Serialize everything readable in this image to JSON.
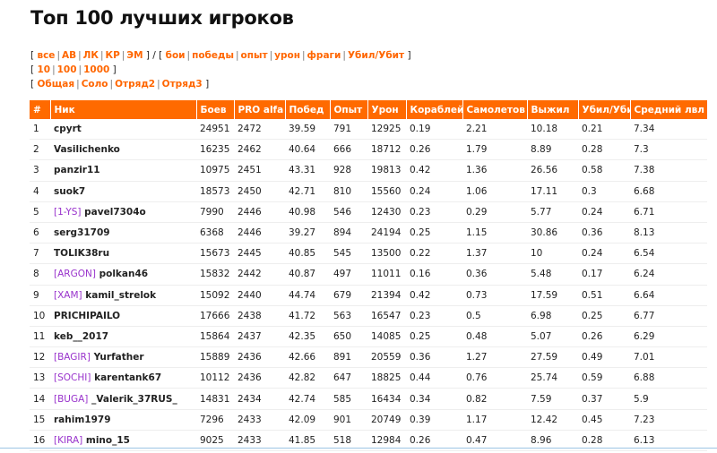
{
  "page": {
    "title": "Топ 100 лучших игроков"
  },
  "filters": {
    "line1_group1": [
      "все",
      "АВ",
      "ЛК",
      "КР",
      "ЭМ"
    ],
    "line1_slash": "/",
    "line1_group2": [
      "бои",
      "победы",
      "опыт",
      "урон",
      "фраги",
      "Убил/Убит"
    ],
    "line2": [
      "10",
      "100",
      "1000"
    ],
    "line3": [
      "Общая",
      "Соло",
      "Отряд2",
      "Отряд3"
    ]
  },
  "table": {
    "columns": [
      "#",
      "Ник",
      "Боев",
      "PRO alfa",
      "Побед",
      "Опыт",
      "Урон",
      "Кораблей",
      "Самолетов",
      "Выжил",
      "Убил/Убит",
      "Средний лвл"
    ],
    "rows": [
      {
        "rank": "1",
        "clan": "",
        "nick": "cpyrt",
        "battles": "24951",
        "pro": "2472",
        "wins": "39.59",
        "exp": "791",
        "dmg": "12925",
        "ships": "0.19",
        "planes": "2.21",
        "survived": "10.18",
        "kd": "0.21",
        "avg_lvl": "7.34"
      },
      {
        "rank": "2",
        "clan": "",
        "nick": "Vasilichenko",
        "battles": "16235",
        "pro": "2462",
        "wins": "40.64",
        "exp": "666",
        "dmg": "18712",
        "ships": "0.26",
        "planes": "1.79",
        "survived": "8.89",
        "kd": "0.28",
        "avg_lvl": "7.3"
      },
      {
        "rank": "3",
        "clan": "",
        "nick": "panzir11",
        "battles": "10975",
        "pro": "2451",
        "wins": "43.31",
        "exp": "928",
        "dmg": "19813",
        "ships": "0.42",
        "planes": "1.36",
        "survived": "26.56",
        "kd": "0.58",
        "avg_lvl": "7.38"
      },
      {
        "rank": "4",
        "clan": "",
        "nick": "suok7",
        "battles": "18573",
        "pro": "2450",
        "wins": "42.71",
        "exp": "810",
        "dmg": "15560",
        "ships": "0.24",
        "planes": "1.06",
        "survived": "17.11",
        "kd": "0.3",
        "avg_lvl": "6.68"
      },
      {
        "rank": "5",
        "clan": "[1-YS]",
        "nick": "pavel7304o",
        "battles": "7990",
        "pro": "2446",
        "wins": "40.98",
        "exp": "546",
        "dmg": "12430",
        "ships": "0.23",
        "planes": "0.29",
        "survived": "5.77",
        "kd": "0.24",
        "avg_lvl": "6.71"
      },
      {
        "rank": "6",
        "clan": "",
        "nick": "serg31709",
        "battles": "6368",
        "pro": "2446",
        "wins": "39.27",
        "exp": "894",
        "dmg": "24194",
        "ships": "0.25",
        "planes": "1.15",
        "survived": "30.86",
        "kd": "0.36",
        "avg_lvl": "8.13"
      },
      {
        "rank": "7",
        "clan": "",
        "nick": "TOLIK38ru",
        "battles": "15673",
        "pro": "2445",
        "wins": "40.85",
        "exp": "545",
        "dmg": "13500",
        "ships": "0.22",
        "planes": "1.37",
        "survived": "10",
        "kd": "0.24",
        "avg_lvl": "6.54"
      },
      {
        "rank": "8",
        "clan": "[ARGON]",
        "nick": "polkan46",
        "battles": "15832",
        "pro": "2442",
        "wins": "40.87",
        "exp": "497",
        "dmg": "11011",
        "ships": "0.16",
        "planes": "0.36",
        "survived": "5.48",
        "kd": "0.17",
        "avg_lvl": "6.24"
      },
      {
        "rank": "9",
        "clan": "[XAM]",
        "nick": "kamil_strelok",
        "battles": "15092",
        "pro": "2440",
        "wins": "44.74",
        "exp": "679",
        "dmg": "21394",
        "ships": "0.42",
        "planes": "0.73",
        "survived": "17.59",
        "kd": "0.51",
        "avg_lvl": "6.64"
      },
      {
        "rank": "10",
        "clan": "",
        "nick": "PRICHIPAILO",
        "battles": "17666",
        "pro": "2438",
        "wins": "41.72",
        "exp": "563",
        "dmg": "16547",
        "ships": "0.23",
        "planes": "0.5",
        "survived": "6.98",
        "kd": "0.25",
        "avg_lvl": "6.77"
      },
      {
        "rank": "11",
        "clan": "",
        "nick": "keb__2017",
        "battles": "15864",
        "pro": "2437",
        "wins": "42.35",
        "exp": "650",
        "dmg": "14085",
        "ships": "0.25",
        "planes": "0.48",
        "survived": "5.07",
        "kd": "0.26",
        "avg_lvl": "6.29"
      },
      {
        "rank": "12",
        "clan": "[BAGIR]",
        "nick": "Yurfather",
        "battles": "15889",
        "pro": "2436",
        "wins": "42.66",
        "exp": "891",
        "dmg": "20559",
        "ships": "0.36",
        "planes": "1.27",
        "survived": "27.59",
        "kd": "0.49",
        "avg_lvl": "7.01"
      },
      {
        "rank": "13",
        "clan": "[SOCHI]",
        "nick": "karentank67",
        "battles": "10112",
        "pro": "2436",
        "wins": "42.82",
        "exp": "647",
        "dmg": "18825",
        "ships": "0.44",
        "planes": "0.76",
        "survived": "25.74",
        "kd": "0.59",
        "avg_lvl": "6.88"
      },
      {
        "rank": "14",
        "clan": "[BUGA]",
        "nick": "_Valerik_37RUS_",
        "battles": "14831",
        "pro": "2434",
        "wins": "42.74",
        "exp": "585",
        "dmg": "16434",
        "ships": "0.34",
        "planes": "0.82",
        "survived": "7.59",
        "kd": "0.37",
        "avg_lvl": "5.9"
      },
      {
        "rank": "15",
        "clan": "",
        "nick": "rahim1979",
        "battles": "7296",
        "pro": "2433",
        "wins": "42.09",
        "exp": "901",
        "dmg": "20749",
        "ships": "0.39",
        "planes": "1.17",
        "survived": "12.42",
        "kd": "0.45",
        "avg_lvl": "7.23"
      },
      {
        "rank": "16",
        "clan": "[KIRA]",
        "nick": "mino_15",
        "battles": "9025",
        "pro": "2433",
        "wins": "41.85",
        "exp": "518",
        "dmg": "12984",
        "ships": "0.26",
        "planes": "0.47",
        "survived": "8.96",
        "kd": "0.28",
        "avg_lvl": "6.13"
      }
    ]
  }
}
